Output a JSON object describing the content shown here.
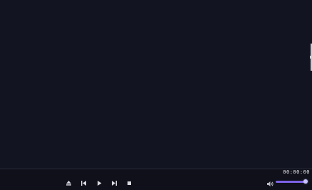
{
  "player": {
    "time_display": "00:00:00",
    "volume_level": 1.0
  },
  "controls": [
    {
      "name": "eject-button",
      "icon": "eject-icon"
    },
    {
      "name": "previous-button",
      "icon": "skip-previous-icon"
    },
    {
      "name": "play-button",
      "icon": "play-icon"
    },
    {
      "name": "next-button",
      "icon": "skip-next-icon"
    },
    {
      "name": "stop-button",
      "icon": "stop-icon"
    }
  ],
  "volume": {
    "icon": "speaker-icon"
  },
  "colors": {
    "background": "#121320",
    "control_bar": "#0f1019",
    "accent": "#7d61e6",
    "icon": "#d9d9e0"
  }
}
